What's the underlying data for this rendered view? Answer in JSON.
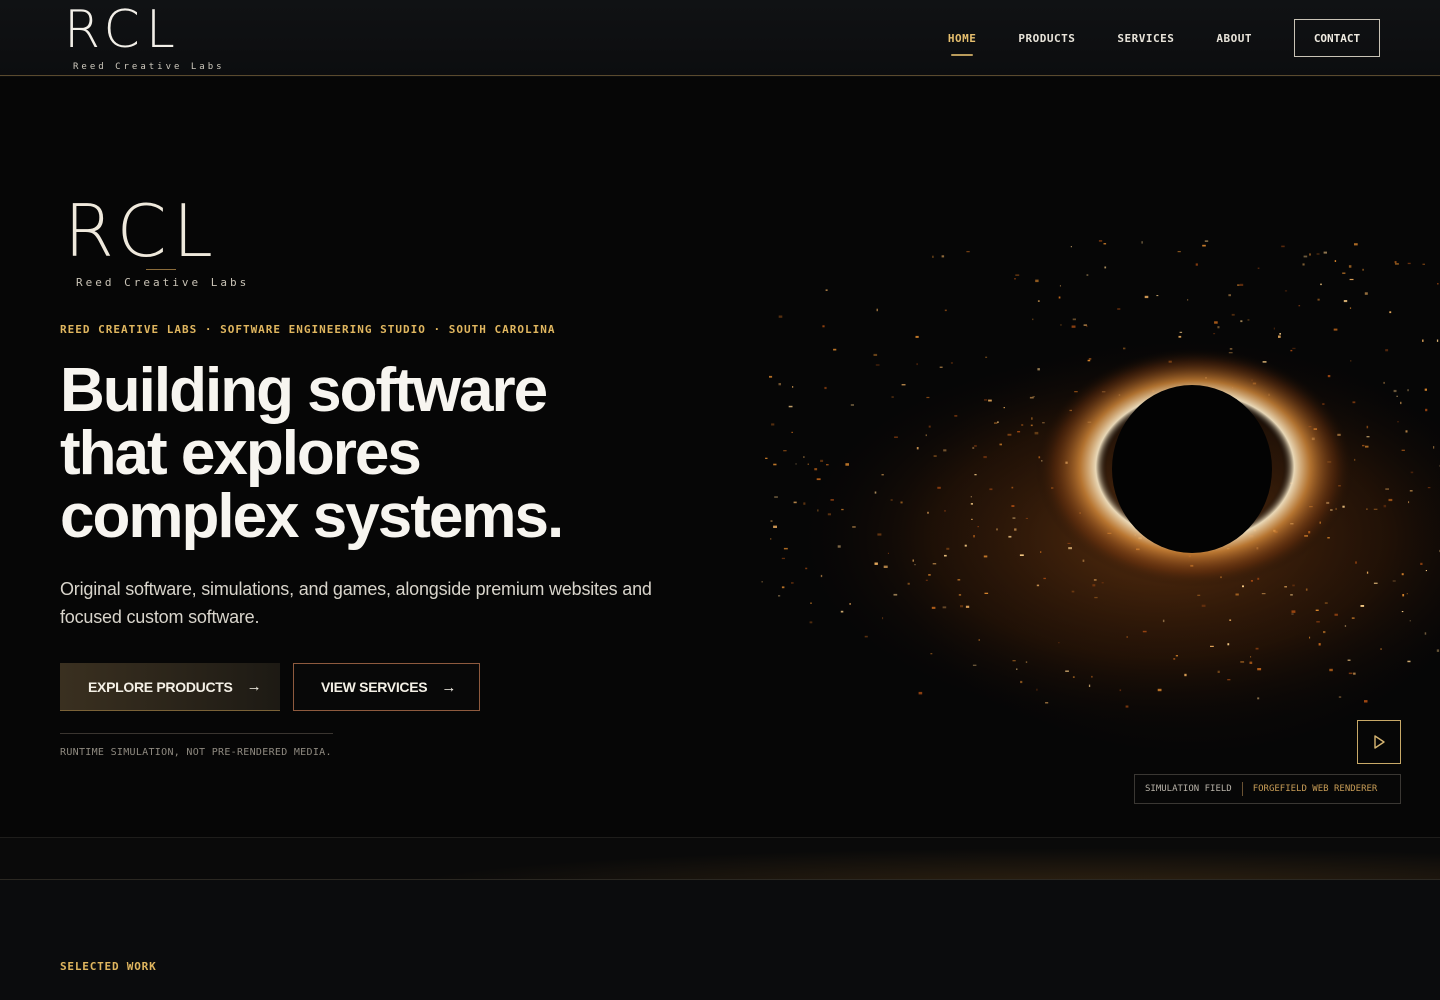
{
  "header": {
    "logo": "RCL",
    "logo_sub": "Reed Creative Labs",
    "nav": [
      "HOME",
      "PRODUCTS",
      "SERVICES",
      "ABOUT"
    ],
    "contact": "CONTACT"
  },
  "hero": {
    "logo": "RCL",
    "logo_sub": "Reed Creative Labs",
    "eyebrow": "REED CREATIVE LABS · SOFTWARE ENGINEERING STUDIO · SOUTH CAROLINA",
    "headline": [
      "Building software",
      "that explores",
      "complex systems."
    ],
    "subtitle": "Original software, simulations, and games, alongside premium websites and focused custom software.",
    "primary_button": "EXPLORE PRODUCTS",
    "secondary_button": "VIEW SERVICES",
    "runtime_note": "RUNTIME SIMULATION, NOT PRE-RENDERED MEDIA.",
    "badge_label": "SIMULATION FIELD",
    "badge_value": "FORGEFIELD WEB RENDERER"
  },
  "section": {
    "label": "SELECTED WORK"
  },
  "colors": {
    "accent": "#e0b65f",
    "background": "#060606"
  },
  "icons": {
    "arrow": "arrow-right-icon",
    "play": "play-icon"
  }
}
